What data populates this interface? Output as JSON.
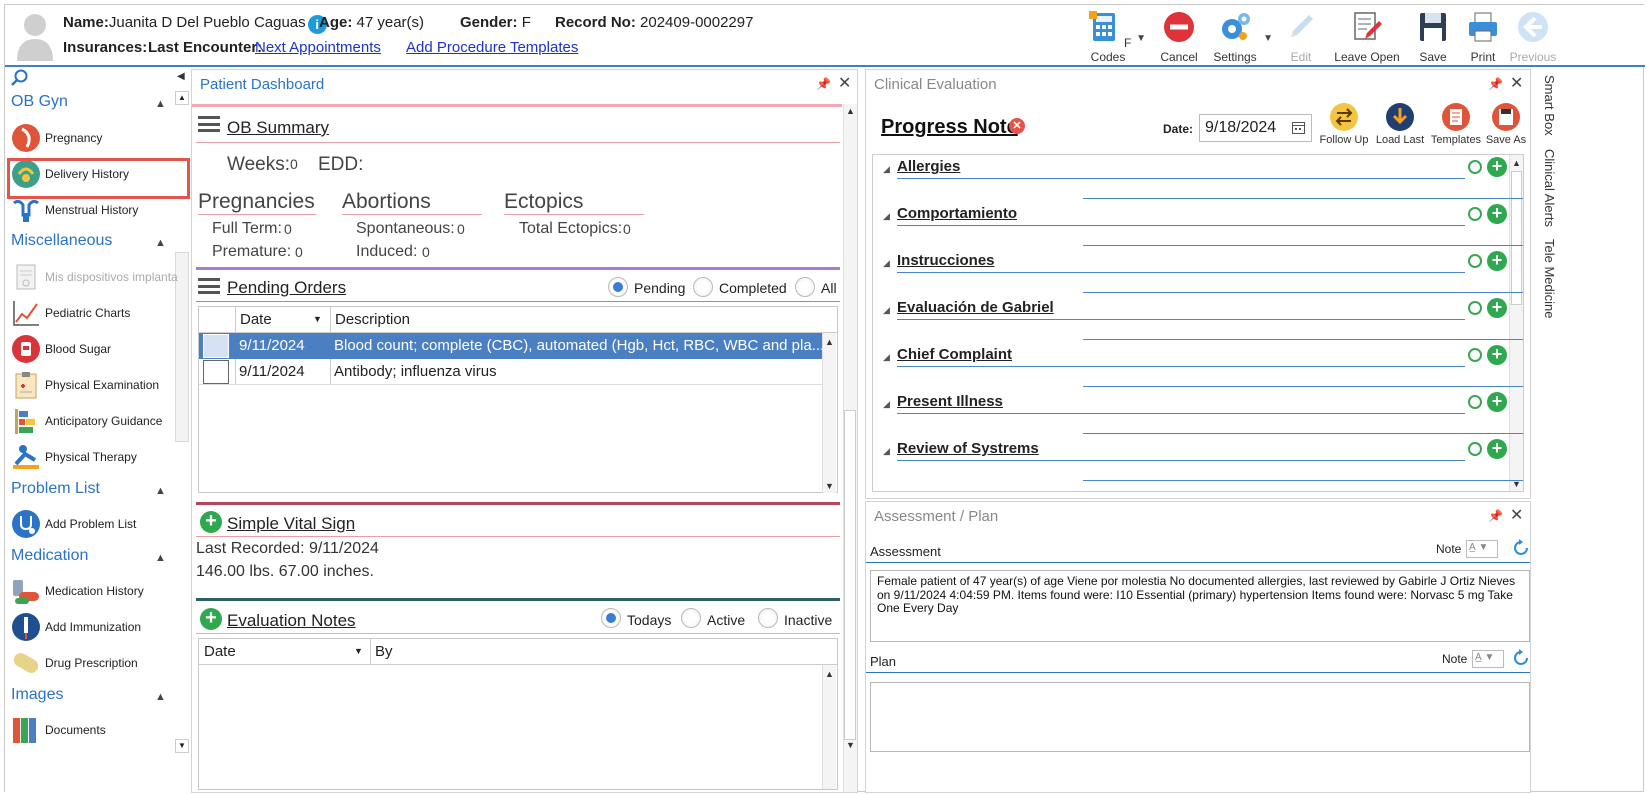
{
  "header": {
    "name_label": "Name:",
    "name_value": "Juanita D Del Pueblo Caguas",
    "age_label": "Age:",
    "age_value": "47 year(s)",
    "gender_label": "Gender:",
    "gender_value": "F",
    "record_label": "Record No:",
    "record_value": "202409-0002297",
    "insurances_label": "Insurances:",
    "last_encounter_label": "Last Encounter:",
    "next_appointments_link": "Next Appointments",
    "add_templates_link": "Add Procedure Templates"
  },
  "toolbar": {
    "fcodes": "F Codes",
    "cancel": "Cancel",
    "settings": "Settings",
    "edit": "Edit",
    "leave_open": "Leave Open",
    "save": "Save",
    "print": "Print",
    "previous": "Previous"
  },
  "sidebar": {
    "ob_gyn": "OB Gyn",
    "pregnancy": "Pregnancy",
    "delivery_history": "Delivery History",
    "menstrual_history": "Menstrual History",
    "miscellaneous": "Miscellaneous",
    "mis_dispositivos": "Mis dispositivos implanta",
    "pediatric_charts": "Pediatric Charts",
    "blood_sugar": "Blood Sugar",
    "physical_examination": "Physical Examination",
    "anticipatory_guidance": "Anticipatory Guidance",
    "physical_therapy": "Physical Therapy",
    "problem_list": "Problem List",
    "add_problem_list": "Add Problem List",
    "medication": "Medication",
    "medication_history": "Medication History",
    "add_immunization": "Add Immunization",
    "drug_prescription": "Drug Prescription",
    "images": "Images",
    "documents": "Documents"
  },
  "dashboard": {
    "title": "Patient Dashboard",
    "ob_summary": "OB Summary",
    "weeks_label": "Weeks:",
    "weeks_value": "0",
    "edd_label": "EDD:",
    "pregnancies": "Pregnancies",
    "full_term": "Full Term:",
    "full_term_value": "0",
    "premature": "Premature:",
    "premature_value": "0",
    "abortions": "Abortions",
    "spontaneous": "Spontaneous:",
    "spontaneous_value": "0",
    "induced": "Induced:",
    "induced_value": "0",
    "ectopics": "Ectopics",
    "total_ectopics": "Total Ectopics:",
    "total_ectopics_value": "0",
    "pending_orders": "Pending Orders",
    "radio_pending": "Pending",
    "radio_completed": "Completed",
    "radio_all": "All",
    "col_date": "Date",
    "col_description": "Description",
    "orders": [
      {
        "date": "9/11/2024",
        "description": "Blood count; complete (CBC), automated (Hgb, Hct, RBC, WBC and pla..."
      },
      {
        "date": "9/11/2024",
        "description": "Antibody; influenza virus"
      }
    ],
    "simple_vital_sign": "Simple Vital Sign",
    "last_recorded": "Last Recorded: 9/11/2024",
    "vitals": "146.00 lbs. 67.00 inches.",
    "evaluation_notes": "Evaluation Notes",
    "radio_todays": "Todays",
    "radio_active": "Active",
    "radio_inactive": "Inactive",
    "col_by": "By"
  },
  "clinical": {
    "title": "Clinical Evaluation",
    "progress_note": "Progress Note",
    "date_label": "Date:",
    "date_value": "9/18/2024",
    "follow_up": "Follow Up",
    "load_last": "Load Last",
    "templates": "Templates",
    "save_as": "Save As",
    "sections": [
      "Allergies",
      "Comportamiento",
      "Instrucciones",
      "Evaluación de Gabriel",
      "Chief Complaint",
      "Present Illness",
      "Review of Systrems"
    ]
  },
  "assessment": {
    "title": "Assessment / Plan",
    "assessment_label": "Assessment",
    "note_label": "Note",
    "text": "Female patient of 47 year(s) of age Viene por molestia     No documented allergies, last reviewed by Gabirle J Ortiz Nieves on 9/11/2024 4:04:59 PM.     Items found were:  I10 Essential (primary) hypertension  Items found were:  Norvasc 5 mg Take One Every Day",
    "plan_label": "Plan",
    "plan_note_label": "Note"
  },
  "right_tabs": {
    "smart_box": "Smart Box",
    "clinical_alerts": "Clinical Alerts",
    "tele_medicine": "Tele Medicine"
  },
  "colors": {
    "accent": "#2a73c6",
    "highlight_row": "#4a7fc1",
    "callout": "#e4544a"
  }
}
